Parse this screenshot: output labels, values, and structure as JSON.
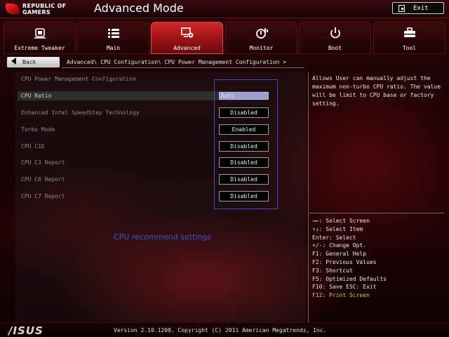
{
  "header": {
    "brand_line1": "REPUBLIC OF",
    "brand_line2": "GAMERS",
    "mode_title": "Advanced Mode",
    "exit_label": "Exit"
  },
  "tabs": [
    {
      "label": "Extreme Tweaker",
      "icon": "tweaker-icon",
      "active": false
    },
    {
      "label": "Main",
      "icon": "list-icon",
      "active": false
    },
    {
      "label": "Advanced",
      "icon": "advanced-icon",
      "active": true
    },
    {
      "label": "Monitor",
      "icon": "monitor-icon",
      "active": false
    },
    {
      "label": "Boot",
      "icon": "power-icon",
      "active": false
    },
    {
      "label": "Tool",
      "icon": "tool-icon",
      "active": false
    }
  ],
  "nav": {
    "back_label": "Back",
    "breadcrumb": "Advanced\\ CPU Configuration\\ CPU Power Management Configuration >"
  },
  "settings": {
    "section_title": "CPU Power Management Configuration",
    "rows": [
      {
        "label": "CPU Ratio",
        "value": "Auto"
      },
      {
        "label": "Enhanced Intel SpeedStep Technology",
        "value": "Disabled"
      },
      {
        "label": "Turbo Mode",
        "value": "Enabled"
      },
      {
        "label": "CPU C1E",
        "value": "Disabled"
      },
      {
        "label": "CPU C3 Report",
        "value": "Disabled"
      },
      {
        "label": "CPU C6 Report",
        "value": "Disabled"
      },
      {
        "label": "CPU C7 Report",
        "value": "Disabled"
      }
    ],
    "annotation": "CPU recommend settings"
  },
  "help": {
    "text": "Allows User can manually adjust the maximum non-turbo CPU ratio. The value will be limit to CPU base or factory setting."
  },
  "keys": [
    "→←: Select Screen",
    "↑↓: Select Item",
    "Enter: Select",
    "+/-: Change Opt.",
    "F1: General Help",
    "F2: Previous Values",
    "F3: Shortcut",
    "F5: Optimized Defaults",
    "F10: Save  ESC: Exit",
    "F12: Print Screen"
  ],
  "footer": {
    "brand": "/ISUS",
    "version": "Version 2.10.1208. Copyright (C) 2011 American Megatrends, Inc."
  },
  "colors": {
    "accent_red": "#c81e24",
    "selected_value": "#9d9ed2",
    "annotation_blue": "#3a4fd0",
    "key_accent": "#d9c74a"
  }
}
